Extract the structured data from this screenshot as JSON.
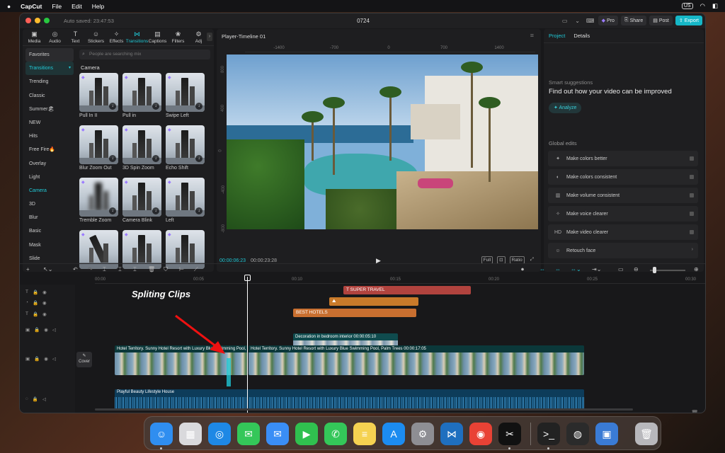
{
  "menubar": {
    "apple": "",
    "app": "CapCut",
    "items": [
      "File",
      "Edit",
      "Help"
    ],
    "keyboard": "US"
  },
  "window": {
    "autosave": "Auto saved: 23:47:53",
    "title": "0724",
    "buttons": {
      "pro": "Pro",
      "share": "Share",
      "post": "Post",
      "export": "Export"
    }
  },
  "media_tabs": [
    {
      "label": "Media",
      "icon": "media-icon",
      "glyph": "▣"
    },
    {
      "label": "Audio",
      "icon": "audio-icon",
      "glyph": "◎"
    },
    {
      "label": "Text",
      "icon": "text-icon",
      "glyph": "T"
    },
    {
      "label": "Stickers",
      "icon": "stickers-icon",
      "glyph": "☺"
    },
    {
      "label": "Effects",
      "icon": "effects-icon",
      "glyph": "✧"
    },
    {
      "label": "Transitions",
      "icon": "transitions-icon",
      "glyph": "⋈"
    },
    {
      "label": "Captions",
      "icon": "captions-icon",
      "glyph": "▤"
    },
    {
      "label": "Filters",
      "icon": "filters-icon",
      "glyph": "❀"
    },
    {
      "label": "Adj",
      "icon": "adjust-icon",
      "glyph": "⚙"
    }
  ],
  "categories": [
    "Favorites",
    "Transitions",
    "Trending",
    "Classic",
    "Summer🏖",
    "NEW",
    "Hits",
    "Free Fire🔥",
    "Overlay",
    "Light",
    "Camera",
    "3D",
    "Blur",
    "Basic",
    "Mask",
    "Slide"
  ],
  "search": {
    "placeholder": "People are searching mix"
  },
  "section": "Camera",
  "transitions": [
    "Pull In II",
    "Pull in",
    "Swipe Left",
    "Blur Zoom Out",
    "3D Spin Zoom",
    "Echo Shift",
    "Tremble Zoom",
    "Camera Blink",
    "Left",
    "",
    "",
    ""
  ],
  "player": {
    "title": "Player-Timeline 01",
    "ruler_h": [
      "-1400",
      "-700",
      "0",
      "700",
      "1400"
    ],
    "ruler_v": [
      "800",
      "400",
      "0",
      "-400",
      "-800"
    ],
    "current": "00:00:06:23",
    "total": "00:00:23:28",
    "icons": [
      "Full",
      "⊡",
      "Ratio",
      "⤢"
    ]
  },
  "right": {
    "tabs": [
      "Project",
      "Details"
    ],
    "smart_title": "Smart suggestions",
    "smart_heading": "Find out how your video can be improved",
    "analyze": "Analyze",
    "global_title": "Global edits",
    "edits": [
      {
        "label": "Make colors better",
        "icon": "magic-icon",
        "glyph": "✦"
      },
      {
        "label": "Make colors consistent",
        "icon": "palette-icon",
        "glyph": "◐"
      },
      {
        "label": "Make volume consistent",
        "icon": "volume-icon",
        "glyph": "▥"
      },
      {
        "label": "Make voice clearer",
        "icon": "voice-icon",
        "glyph": "✧"
      },
      {
        "label": "Make video clearer",
        "icon": "hd-icon",
        "glyph": "HD"
      },
      {
        "label": "Retouch face",
        "icon": "face-icon",
        "glyph": "☺"
      }
    ]
  },
  "timeline": {
    "ticks": [
      "00:00",
      "00:05",
      "00:10",
      "00:15",
      "00:20",
      "00:25",
      "00:30"
    ],
    "clips": {
      "super": "SUPER TRAVEL",
      "best": "BEST HOTELS",
      "deco": "Decoration in bedroom interior  00:00:05:10",
      "video1": "Hotel Territory. Sunny Hotel Resort with Luxury Blue Swimming Pool, Palm Trees",
      "video2": "Hotel Territory. Sunny Hotel Resort with Luxury Blue Swimming Pool, Palm Trees  00:00:17:05",
      "audio": "Playful Beauty Lifestyle House"
    },
    "cover": "Cover"
  },
  "annotation": "Spliting Clips",
  "dock": [
    {
      "name": "finder-icon",
      "color": "#2f8ef0",
      "glyph": "☺"
    },
    {
      "name": "launchpad-icon",
      "color": "#d9d9dc",
      "glyph": "▦"
    },
    {
      "name": "safari-icon",
      "color": "#1e88e5",
      "glyph": "◎"
    },
    {
      "name": "messages-icon",
      "color": "#34c759",
      "glyph": "✉"
    },
    {
      "name": "mail-icon",
      "color": "#3a8ef6",
      "glyph": "✉"
    },
    {
      "name": "facetime-icon",
      "color": "#30c04f",
      "glyph": "▶"
    },
    {
      "name": "phone-icon",
      "color": "#34c759",
      "glyph": "✆"
    },
    {
      "name": "notes-icon",
      "color": "#f5d251",
      "glyph": "≡"
    },
    {
      "name": "appstore-icon",
      "color": "#1c8cf0",
      "glyph": "A"
    },
    {
      "name": "settings-icon",
      "color": "#8e8e93",
      "glyph": "⚙"
    },
    {
      "name": "vscode-icon",
      "color": "#1f6fbf",
      "glyph": "⋈"
    },
    {
      "name": "chrome-icon",
      "color": "#e94235",
      "glyph": "◉"
    },
    {
      "name": "capcut-icon",
      "color": "#111",
      "glyph": "✂"
    },
    {
      "name": "terminal-icon",
      "color": "#222",
      "glyph": ">_"
    },
    {
      "name": "obs-icon",
      "color": "#2b2b2b",
      "glyph": "◍"
    },
    {
      "name": "vpn-icon",
      "color": "#3a7bd5",
      "glyph": "▣"
    },
    {
      "name": "trash-icon",
      "color": "#b8b8bc",
      "glyph": "🗑"
    }
  ]
}
